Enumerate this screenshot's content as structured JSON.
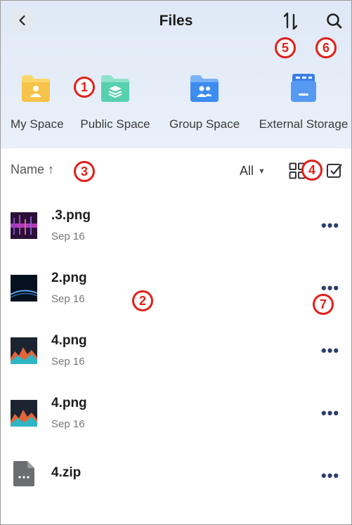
{
  "header": {
    "title": "Files"
  },
  "spaces": [
    {
      "label": "My Space",
      "color": "#f7c34a"
    },
    {
      "label": "Public Space",
      "color": "#57d0b0"
    },
    {
      "label": "Group Space",
      "color": "#3d8cf0"
    },
    {
      "label": "External Storage",
      "color": "#3a85ee"
    }
  ],
  "toolbar": {
    "sort_label": "Name",
    "sort_arrow": "↑",
    "filter_label": "All"
  },
  "files": [
    {
      "name": ".3.png",
      "date": "Sep 16"
    },
    {
      "name": "2.png",
      "date": "Sep 16"
    },
    {
      "name": "4.png",
      "date": "Sep 16"
    },
    {
      "name": "4.png",
      "date": "Sep 16"
    },
    {
      "name": "4.zip",
      "date": ""
    }
  ],
  "annotations": [
    "1",
    "2",
    "3",
    "4",
    "5",
    "6",
    "7"
  ],
  "more_label": "•••",
  "colors": {
    "accent": "#2c3e6b",
    "annotation": "#e0201a"
  }
}
